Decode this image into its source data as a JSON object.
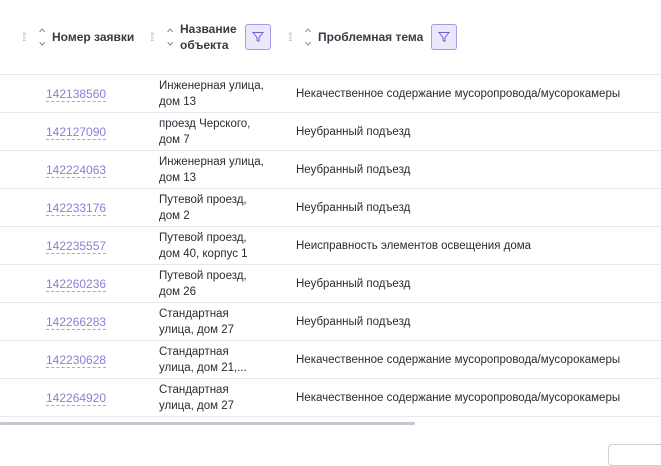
{
  "headers": {
    "number": "Номер заявки",
    "object_line1": "Название",
    "object_line2": "объекта",
    "topic": "Проблемная тема"
  },
  "rows": [
    {
      "number": "142138560",
      "object_line1": "Инженерная улица,",
      "object_line2": "дом 13",
      "topic": "Некачественное содержание мусоропровода/мусорокамеры"
    },
    {
      "number": "142127090",
      "object_line1": "проезд Черского,",
      "object_line2": "дом 7",
      "topic": "Неубранный подъезд"
    },
    {
      "number": "142224063",
      "object_line1": "Инженерная улица,",
      "object_line2": "дом 13",
      "topic": "Неубранный подъезд"
    },
    {
      "number": "142233176",
      "object_line1": "Путевой проезд,",
      "object_line2": "дом 2",
      "topic": "Неубранный подъезд"
    },
    {
      "number": "142235557",
      "object_line1": "Путевой проезд,",
      "object_line2": "дом 40, корпус 1",
      "topic": "Неисправность элементов освещения дома"
    },
    {
      "number": "142260236",
      "object_line1": "Путевой проезд,",
      "object_line2": "дом 26",
      "topic": "Неубранный подъезд"
    },
    {
      "number": "142266283",
      "object_line1": "Стандартная",
      "object_line2": "улица, дом 27",
      "topic": "Неубранный подъезд"
    },
    {
      "number": "142230628",
      "object_line1": "Стандартная",
      "object_line2": "улица, дом 21,...",
      "topic": "Некачественное содержание мусоропровода/мусорокамеры"
    },
    {
      "number": "142264920",
      "object_line1": "Стандартная",
      "object_line2": "улица, дом 27",
      "topic": "Некачественное содержание мусоропровода/мусорокамеры"
    }
  ],
  "icons": {
    "drag": "drag-handle-icon",
    "sort": "sort-icon",
    "filter": "filter-icon"
  },
  "colors": {
    "link": "#8a7fd6",
    "filter_bg": "#ece8fb",
    "filter_border": "#a89ae6"
  }
}
